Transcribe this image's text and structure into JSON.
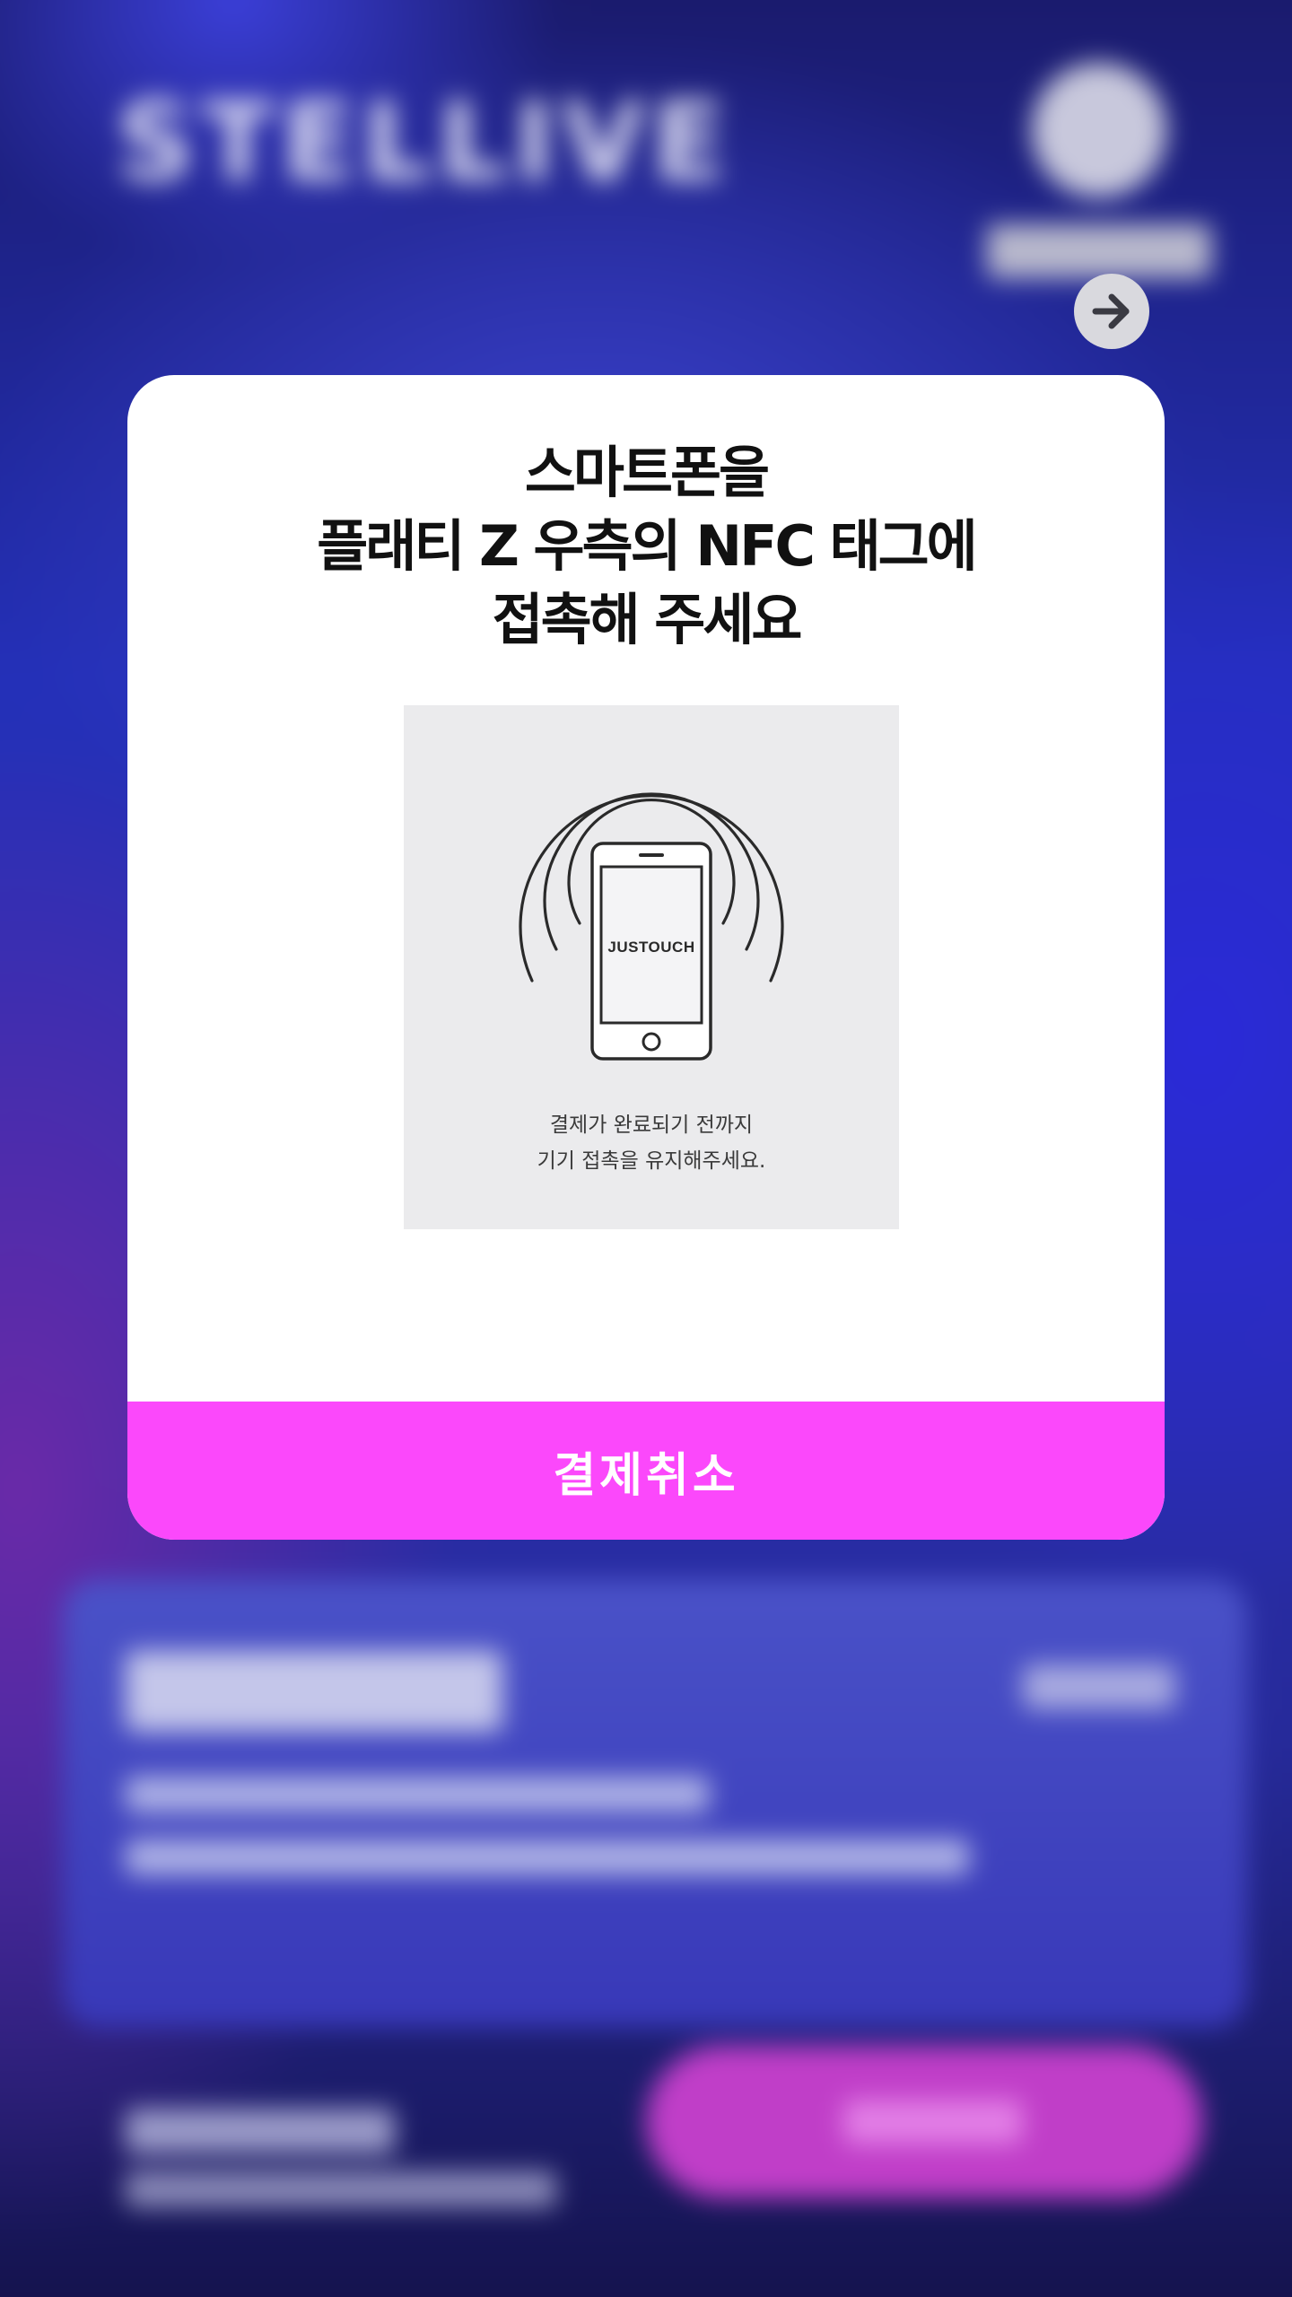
{
  "background": {
    "logo_text": "STELLIVE",
    "bg_colors": {
      "deep": "#14124a",
      "mid": "#2430b8",
      "accent": "#c03ec8"
    }
  },
  "arrow_button": {
    "icon": "arrow-right-icon"
  },
  "modal": {
    "title_lines": [
      "스마트폰을",
      "플래티 Z 우측의 NFC 태그에",
      "접촉해 주세요"
    ],
    "illustration": {
      "phone_screen_text": "JUSTOUCH",
      "caption_lines": [
        "결제가 완료되기 전까지",
        "기기 접촉을 유지해주세요."
      ]
    },
    "cancel_button_label": "결제취소",
    "colors": {
      "accent": "#fb48fb",
      "panel": "#ffffff",
      "figure_bg": "#ebebed"
    }
  }
}
